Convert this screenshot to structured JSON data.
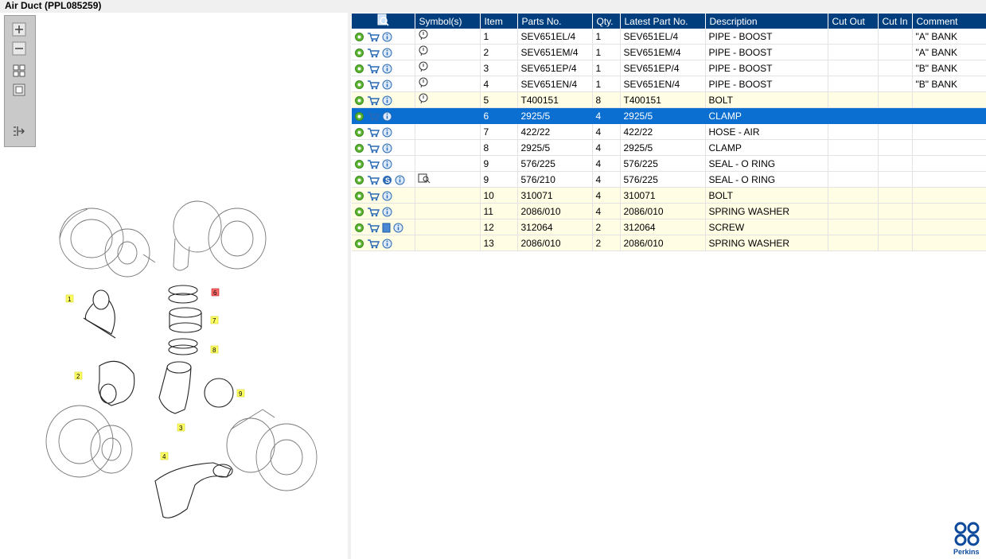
{
  "window": {
    "title": "Air Duct (PPL085259)"
  },
  "zoom_tools": [
    "zoom-in-icon",
    "zoom-out-icon",
    "fit-to-window-icon",
    "actual-size-icon",
    "next-illustration-icon"
  ],
  "table": {
    "columns": [
      "Symbol(s)",
      "Item",
      "Parts No.",
      "Qty.",
      "Latest Part No.",
      "Description",
      "Cut Out",
      "Cut In",
      "Comment"
    ],
    "rows": [
      {
        "item": "1",
        "part": "SEV651EL/4",
        "qty": "1",
        "latest": "SEV651EL/4",
        "desc": "PIPE - BOOST",
        "cutout": "",
        "cutin": "",
        "comment": "\"A\" BANK"
      },
      {
        "item": "2",
        "part": "SEV651EM/4",
        "qty": "1",
        "latest": "SEV651EM/4",
        "desc": "PIPE - BOOST",
        "cutout": "",
        "cutin": "",
        "comment": "\"A\" BANK"
      },
      {
        "item": "3",
        "part": "SEV651EP/4",
        "qty": "1",
        "latest": "SEV651EP/4",
        "desc": "PIPE - BOOST",
        "cutout": "",
        "cutin": "",
        "comment": "\"B\" BANK"
      },
      {
        "item": "4",
        "part": "SEV651EN/4",
        "qty": "1",
        "latest": "SEV651EN/4",
        "desc": "PIPE - BOOST",
        "cutout": "",
        "cutin": "",
        "comment": "\"B\" BANK"
      },
      {
        "item": "5",
        "part": "T400151",
        "qty": "8",
        "latest": "T400151",
        "desc": "BOLT",
        "cutout": "",
        "cutin": "",
        "comment": ""
      },
      {
        "item": "6",
        "part": "2925/5",
        "qty": "4",
        "latest": "2925/5",
        "desc": "CLAMP",
        "cutout": "",
        "cutin": "",
        "comment": ""
      },
      {
        "item": "7",
        "part": "422/22",
        "qty": "4",
        "latest": "422/22",
        "desc": "HOSE - AIR",
        "cutout": "",
        "cutin": "",
        "comment": ""
      },
      {
        "item": "8",
        "part": "2925/5",
        "qty": "4",
        "latest": "2925/5",
        "desc": "CLAMP",
        "cutout": "",
        "cutin": "",
        "comment": ""
      },
      {
        "item": "9",
        "part": "576/225",
        "qty": "4",
        "latest": "576/225",
        "desc": "SEAL - O RING",
        "cutout": "",
        "cutin": "",
        "comment": ""
      },
      {
        "item": "9",
        "part": "576/210",
        "qty": "4",
        "latest": "576/225",
        "desc": "SEAL - O RING",
        "cutout": "",
        "cutin": "",
        "comment": ""
      },
      {
        "item": "10",
        "part": "310071",
        "qty": "4",
        "latest": "310071",
        "desc": "BOLT",
        "cutout": "",
        "cutin": "",
        "comment": ""
      },
      {
        "item": "11",
        "part": "2086/010",
        "qty": "4",
        "latest": "2086/010",
        "desc": "SPRING WASHER",
        "cutout": "",
        "cutin": "",
        "comment": ""
      },
      {
        "item": "12",
        "part": "312064",
        "qty": "2",
        "latest": "312064",
        "desc": "SCREW",
        "cutout": "",
        "cutin": "",
        "comment": ""
      },
      {
        "item": "13",
        "part": "2086/010",
        "qty": "2",
        "latest": "2086/010",
        "desc": "SPRING WASHER",
        "cutout": "",
        "cutin": "",
        "comment": ""
      }
    ]
  },
  "diagram": {
    "callouts": [
      "1",
      "2",
      "3",
      "4",
      "6",
      "7",
      "8",
      "9"
    ]
  },
  "brand": {
    "name": "Perkins",
    "color": "#0d4a9c"
  },
  "colors": {
    "header": "#003e7e",
    "selected": "#0a6fd1",
    "highlight": "#fffde3"
  }
}
